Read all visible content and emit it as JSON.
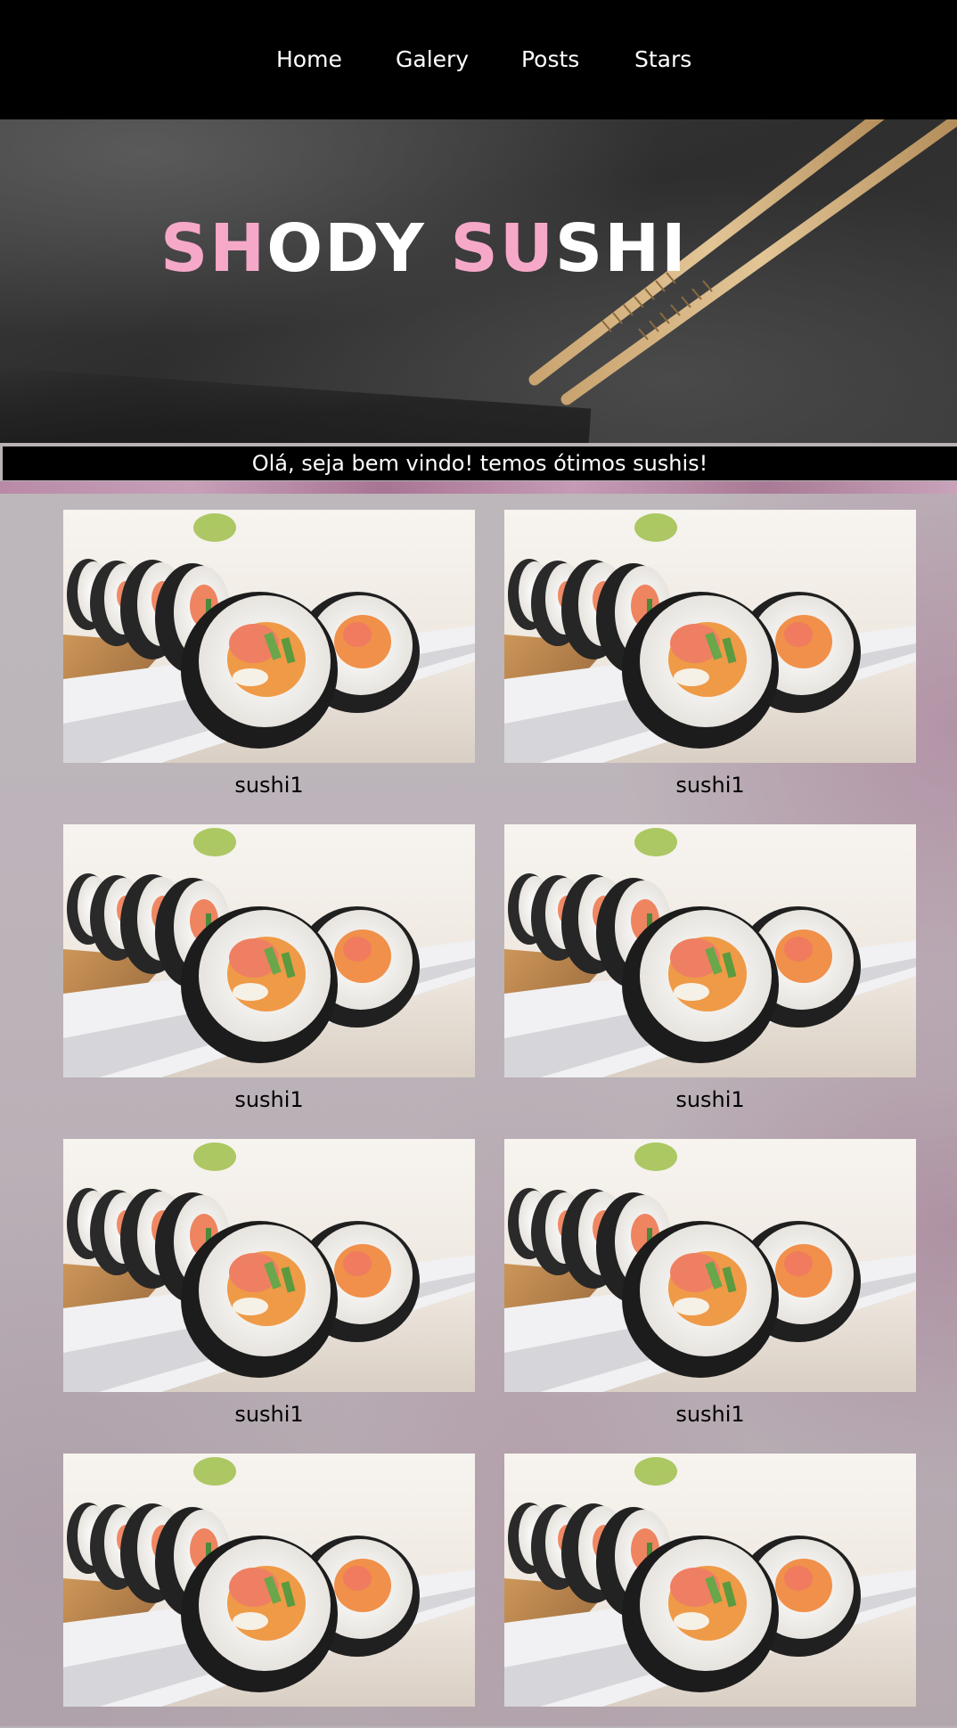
{
  "nav": {
    "items": [
      {
        "label": "Home"
      },
      {
        "label": "Galery"
      },
      {
        "label": "Posts"
      },
      {
        "label": "Stars"
      }
    ]
  },
  "hero": {
    "title_parts": [
      {
        "text": "SH",
        "color": "#f6a8c8"
      },
      {
        "text": "ODY ",
        "color": "#ffffff"
      },
      {
        "text": "SU",
        "color": "#f6a8c8"
      },
      {
        "text": "SHI",
        "color": "#ffffff"
      }
    ]
  },
  "welcome": {
    "text": "Olá, seja bem vindo! temos ótimos sushis!"
  },
  "gallery": {
    "items": [
      {
        "caption": "sushi1"
      },
      {
        "caption": "sushi1"
      },
      {
        "caption": "sushi1"
      },
      {
        "caption": "sushi1"
      },
      {
        "caption": "sushi1"
      },
      {
        "caption": "sushi1"
      },
      {
        "caption": ""
      },
      {
        "caption": ""
      }
    ]
  },
  "colors": {
    "nav_bg": "#000000",
    "accent_pink": "#f6a8c8",
    "welcome_bg": "#000000"
  }
}
